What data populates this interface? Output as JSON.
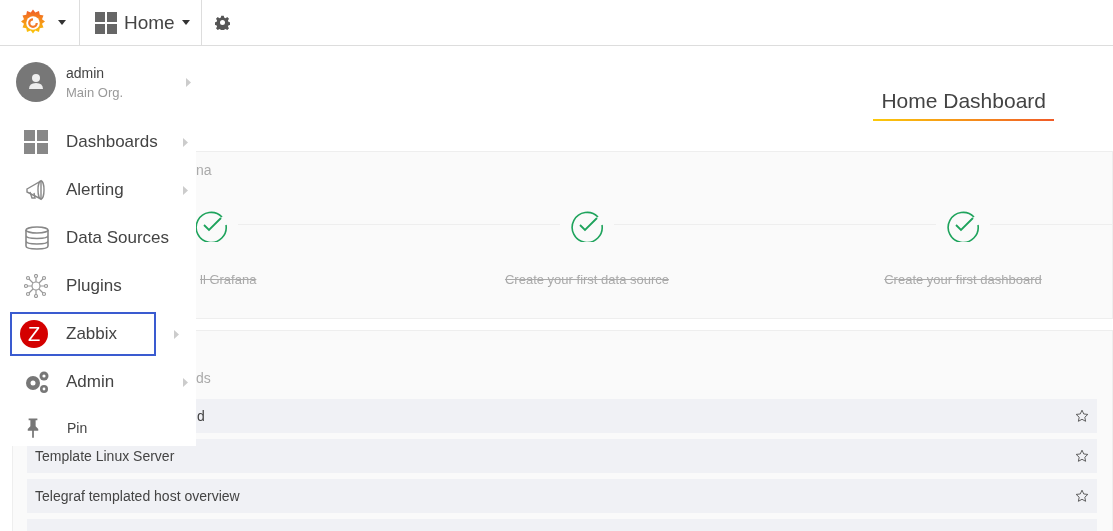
{
  "topbar": {
    "home_label": "Home"
  },
  "menu": {
    "user": {
      "name": "admin",
      "org": "Main Org.",
      "has_submenu": true
    },
    "items": [
      {
        "kind": "dashboards",
        "label": "Dashboards",
        "has_submenu": true,
        "selected": false
      },
      {
        "kind": "alerting",
        "label": "Alerting",
        "has_submenu": true,
        "selected": false
      },
      {
        "kind": "datasources",
        "label": "Data Sources",
        "has_submenu": false,
        "selected": false
      },
      {
        "kind": "plugins",
        "label": "Plugins",
        "has_submenu": false,
        "selected": false
      },
      {
        "kind": "zabbix",
        "label": "Zabbix",
        "badge": "Z",
        "has_submenu": true,
        "selected": true
      },
      {
        "kind": "admin",
        "label": "Admin",
        "has_submenu": true,
        "selected": false
      }
    ],
    "pin": {
      "label": "Pin"
    }
  },
  "page_title": "Home Dashboard",
  "getting_started": {
    "title": "na",
    "steps": [
      {
        "label": "ll Grafana",
        "done": true
      },
      {
        "label": "Create your first data source",
        "done": true
      },
      {
        "label": "Create your first dashboard",
        "done": true
      }
    ]
  },
  "dashboards": {
    "title": "ds",
    "rows": [
      {
        "name": "d",
        "starred": false
      },
      {
        "name": "Template Linux Server",
        "starred": false
      },
      {
        "name": "Telegraf templated host overview",
        "starred": false
      }
    ]
  }
}
